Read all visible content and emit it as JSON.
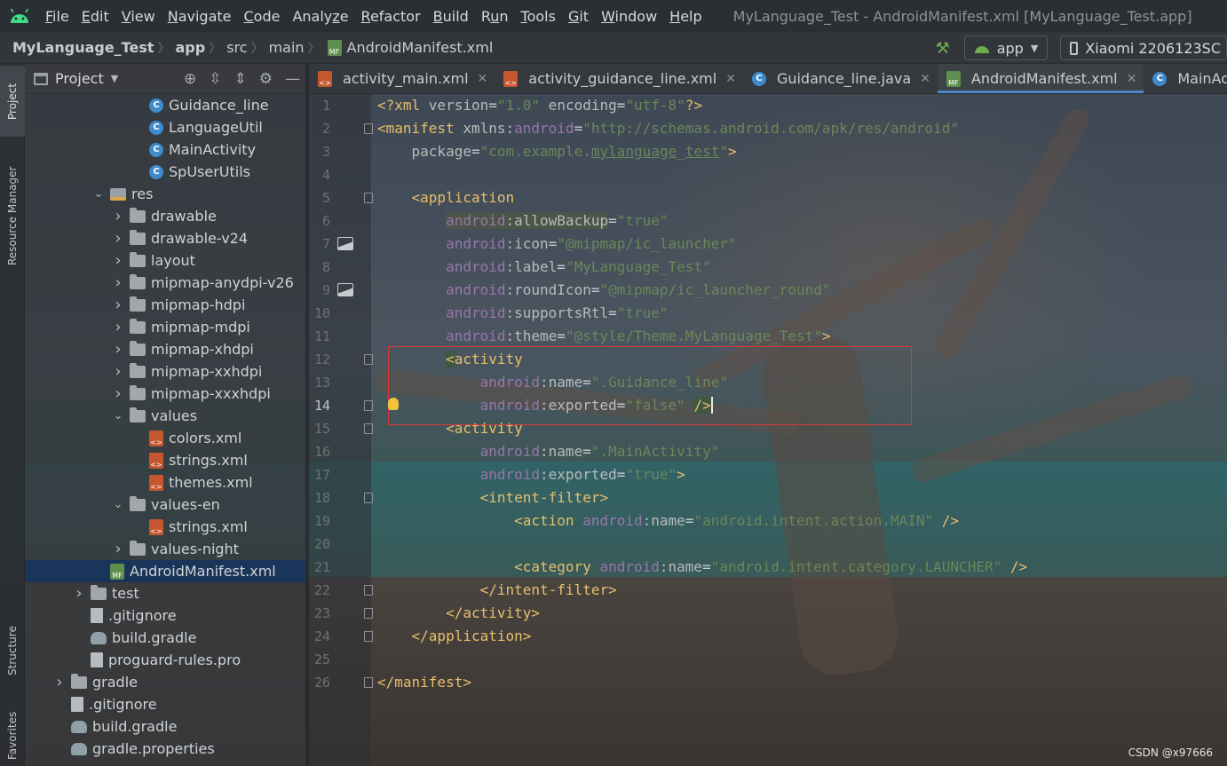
{
  "menu": {
    "items": [
      {
        "label": "File",
        "mnemonic_index": 0
      },
      {
        "label": "Edit",
        "mnemonic_index": 0
      },
      {
        "label": "View",
        "mnemonic_index": 0
      },
      {
        "label": "Navigate",
        "mnemonic_index": 0
      },
      {
        "label": "Code",
        "mnemonic_index": 0
      },
      {
        "label": "Analyze",
        "mnemonic_index": 5
      },
      {
        "label": "Refactor",
        "mnemonic_index": 0
      },
      {
        "label": "Build",
        "mnemonic_index": 0
      },
      {
        "label": "Run",
        "mnemonic_index": 1
      },
      {
        "label": "Tools",
        "mnemonic_index": 0
      },
      {
        "label": "Git",
        "mnemonic_index": 0
      },
      {
        "label": "Window",
        "mnemonic_index": 0
      },
      {
        "label": "Help",
        "mnemonic_index": 0
      }
    ],
    "window_title": "MyLanguage_Test - AndroidManifest.xml [MyLanguage_Test.app]"
  },
  "breadcrumb": [
    "MyLanguage_Test",
    "app",
    "src",
    "main",
    "AndroidManifest.xml"
  ],
  "toolbar": {
    "run_config": "app",
    "device": "Xiaomi 2206123SC"
  },
  "side_tabs": {
    "project": "Project",
    "resource_manager": "Resource Manager",
    "structure": "Structure",
    "favorites": "Favorites"
  },
  "project_panel": {
    "title": "Project",
    "tree": [
      {
        "label": "Guidance_line",
        "icon": "class",
        "indent": 5,
        "arrow": ""
      },
      {
        "label": "LanguageUtil",
        "icon": "class",
        "indent": 5,
        "arrow": ""
      },
      {
        "label": "MainActivity",
        "icon": "class",
        "indent": 5,
        "arrow": ""
      },
      {
        "label": "SpUserUtils",
        "icon": "class",
        "indent": 5,
        "arrow": ""
      },
      {
        "label": "res",
        "icon": "res",
        "indent": 3,
        "arrow": "open"
      },
      {
        "label": "drawable",
        "icon": "folder",
        "indent": 4,
        "arrow": "closed"
      },
      {
        "label": "drawable-v24",
        "icon": "folder",
        "indent": 4,
        "arrow": "closed"
      },
      {
        "label": "layout",
        "icon": "folder",
        "indent": 4,
        "arrow": "closed"
      },
      {
        "label": "mipmap-anydpi-v26",
        "icon": "folder",
        "indent": 4,
        "arrow": "closed"
      },
      {
        "label": "mipmap-hdpi",
        "icon": "folder",
        "indent": 4,
        "arrow": "closed"
      },
      {
        "label": "mipmap-mdpi",
        "icon": "folder",
        "indent": 4,
        "arrow": "closed"
      },
      {
        "label": "mipmap-xhdpi",
        "icon": "folder",
        "indent": 4,
        "arrow": "closed"
      },
      {
        "label": "mipmap-xxhdpi",
        "icon": "folder",
        "indent": 4,
        "arrow": "closed"
      },
      {
        "label": "mipmap-xxxhdpi",
        "icon": "folder",
        "indent": 4,
        "arrow": "closed"
      },
      {
        "label": "values",
        "icon": "folder",
        "indent": 4,
        "arrow": "open"
      },
      {
        "label": "colors.xml",
        "icon": "xml",
        "indent": 5,
        "arrow": ""
      },
      {
        "label": "strings.xml",
        "icon": "xml",
        "indent": 5,
        "arrow": ""
      },
      {
        "label": "themes.xml",
        "icon": "xml",
        "indent": 5,
        "arrow": ""
      },
      {
        "label": "values-en",
        "icon": "folder",
        "indent": 4,
        "arrow": "open"
      },
      {
        "label": "strings.xml",
        "icon": "xml",
        "indent": 5,
        "arrow": ""
      },
      {
        "label": "values-night",
        "icon": "folder",
        "indent": 4,
        "arrow": "closed"
      },
      {
        "label": "AndroidManifest.xml",
        "icon": "mf",
        "indent": 3,
        "arrow": "",
        "selected": true
      },
      {
        "label": "test",
        "icon": "folder",
        "indent": 2,
        "arrow": "closed"
      },
      {
        "label": ".gitignore",
        "icon": "file",
        "indent": 2,
        "arrow": ""
      },
      {
        "label": "build.gradle",
        "icon": "gradle",
        "indent": 2,
        "arrow": ""
      },
      {
        "label": "proguard-rules.pro",
        "icon": "file",
        "indent": 2,
        "arrow": ""
      },
      {
        "label": "gradle",
        "icon": "folder",
        "indent": 1,
        "arrow": "closed"
      },
      {
        "label": ".gitignore",
        "icon": "file",
        "indent": 1,
        "arrow": ""
      },
      {
        "label": "build.gradle",
        "icon": "gradle",
        "indent": 1,
        "arrow": ""
      },
      {
        "label": "gradle.properties",
        "icon": "gradle",
        "indent": 1,
        "arrow": ""
      }
    ]
  },
  "editor_tabs": [
    {
      "label": "activity_main.xml",
      "icon": "xml",
      "active": false,
      "closable": true
    },
    {
      "label": "activity_guidance_line.xml",
      "icon": "xml",
      "active": false,
      "closable": true
    },
    {
      "label": "Guidance_line.java",
      "icon": "class",
      "active": false,
      "closable": true
    },
    {
      "label": "AndroidManifest.xml",
      "icon": "mf",
      "active": true,
      "closable": true
    },
    {
      "label": "MainActivity.java",
      "icon": "class",
      "active": false,
      "closable": false
    }
  ],
  "editor": {
    "current_line": 14,
    "image_gutter_lines": [
      7,
      9
    ],
    "fold_lines": [
      2,
      5,
      12,
      14,
      15,
      18,
      22,
      23,
      24,
      26
    ],
    "lines": [
      [
        [
          "t-tag",
          "<?xml "
        ],
        [
          "t-attr",
          "version"
        ],
        [
          "",
          "="
        ],
        [
          "t-val",
          "\"1.0\""
        ],
        [
          "t-attr",
          " encoding"
        ],
        [
          "",
          "="
        ],
        [
          "t-val",
          "\"utf-8\""
        ],
        [
          "t-tag",
          "?>"
        ]
      ],
      [
        [
          "t-tag",
          "<manifest "
        ],
        [
          "t-attr",
          "xmlns:"
        ],
        [
          "t-ns",
          "android"
        ],
        [
          "",
          "="
        ],
        [
          "t-val",
          "\"http://schemas.android.com/apk/res/android\""
        ]
      ],
      [
        [
          "",
          "    "
        ],
        [
          "t-attr",
          "package"
        ],
        [
          "",
          "="
        ],
        [
          "t-val",
          "\"com.example."
        ],
        [
          "t-val t-under",
          "mylanguage"
        ],
        [
          "t-val",
          "_"
        ],
        [
          "t-val t-under",
          "test"
        ],
        [
          "t-val",
          "\""
        ],
        [
          "t-tag",
          ">"
        ]
      ],
      [],
      [
        [
          "",
          "    "
        ],
        [
          "t-tag",
          "<application"
        ]
      ],
      [
        [
          "",
          "        "
        ],
        [
          "t-ns t-hl",
          "android"
        ],
        [
          "t-attr t-hl",
          ":allowBackup"
        ],
        [
          "",
          "="
        ],
        [
          "t-val",
          "\"true\""
        ]
      ],
      [
        [
          "",
          "        "
        ],
        [
          "t-ns",
          "android"
        ],
        [
          "t-attr",
          ":icon"
        ],
        [
          "",
          "="
        ],
        [
          "t-val",
          "\"@mipmap/ic_launcher\""
        ]
      ],
      [
        [
          "",
          "        "
        ],
        [
          "t-ns",
          "android"
        ],
        [
          "t-attr",
          ":label"
        ],
        [
          "",
          "="
        ],
        [
          "t-val",
          "\"MyLanguage_Test\""
        ]
      ],
      [
        [
          "",
          "        "
        ],
        [
          "t-ns",
          "android"
        ],
        [
          "t-attr",
          ":roundIcon"
        ],
        [
          "",
          "="
        ],
        [
          "t-val",
          "\"@mipmap/ic_launcher_round\""
        ]
      ],
      [
        [
          "",
          "        "
        ],
        [
          "t-ns",
          "android"
        ],
        [
          "t-attr",
          ":supportsRtl"
        ],
        [
          "",
          "="
        ],
        [
          "t-val",
          "\"true\""
        ]
      ],
      [
        [
          "",
          "        "
        ],
        [
          "t-ns",
          "android"
        ],
        [
          "t-attr",
          ":theme"
        ],
        [
          "",
          "="
        ],
        [
          "t-val",
          "\"@style/Theme.MyLanguage_Test\""
        ],
        [
          "t-tag",
          ">"
        ]
      ],
      [
        [
          "",
          "        "
        ],
        [
          "t-tag t-bracket-hl",
          "<"
        ],
        [
          "t-tag",
          "activity"
        ]
      ],
      [
        [
          "",
          "            "
        ],
        [
          "t-ns",
          "android"
        ],
        [
          "t-attr",
          ":name"
        ],
        [
          "",
          "="
        ],
        [
          "t-val",
          "\".Guidance_line\""
        ]
      ],
      [
        [
          "",
          "            "
        ],
        [
          "t-ns",
          "android"
        ],
        [
          "t-attr",
          ":exported"
        ],
        [
          "",
          "="
        ],
        [
          "t-val",
          "\"false\""
        ],
        [
          "",
          " "
        ],
        [
          "t-tag t-bracket-hl t-cursor",
          "/>"
        ]
      ],
      [
        [
          "",
          "        "
        ],
        [
          "t-tag",
          "<activity"
        ]
      ],
      [
        [
          "",
          "            "
        ],
        [
          "t-ns",
          "android"
        ],
        [
          "t-attr",
          ":name"
        ],
        [
          "",
          "="
        ],
        [
          "t-val",
          "\".MainActivity\""
        ]
      ],
      [
        [
          "",
          "            "
        ],
        [
          "t-ns",
          "android"
        ],
        [
          "t-attr",
          ":exported"
        ],
        [
          "",
          "="
        ],
        [
          "t-val",
          "\"true\""
        ],
        [
          "t-tag",
          ">"
        ]
      ],
      [
        [
          "",
          "            "
        ],
        [
          "t-tag",
          "<intent-filter>"
        ]
      ],
      [
        [
          "",
          "                "
        ],
        [
          "t-tag",
          "<action "
        ],
        [
          "t-ns",
          "android"
        ],
        [
          "t-attr",
          ":name"
        ],
        [
          "",
          "="
        ],
        [
          "t-val",
          "\"android.intent.action.MAIN\""
        ],
        [
          "t-tag",
          " />"
        ]
      ],
      [],
      [
        [
          "",
          "                "
        ],
        [
          "t-tag",
          "<category "
        ],
        [
          "t-ns",
          "android"
        ],
        [
          "t-attr",
          ":name"
        ],
        [
          "",
          "="
        ],
        [
          "t-val",
          "\"android.intent.category.LAUNCHER\""
        ],
        [
          "t-tag",
          " />"
        ]
      ],
      [
        [
          "",
          "            "
        ],
        [
          "t-tag",
          "</intent-filter>"
        ]
      ],
      [
        [
          "",
          "        "
        ],
        [
          "t-tag",
          "</activity>"
        ]
      ],
      [
        [
          "",
          "    "
        ],
        [
          "t-tag",
          "</application>"
        ]
      ],
      [],
      [
        [
          "t-tag",
          "</manifest>"
        ]
      ]
    ]
  },
  "watermark": "CSDN @x97666",
  "colors": {
    "tag": "#e8bf6a",
    "namespace": "#9876aa",
    "value": "#6a8759",
    "highlight_box": "#d93a3a",
    "selection": "#16345c"
  }
}
